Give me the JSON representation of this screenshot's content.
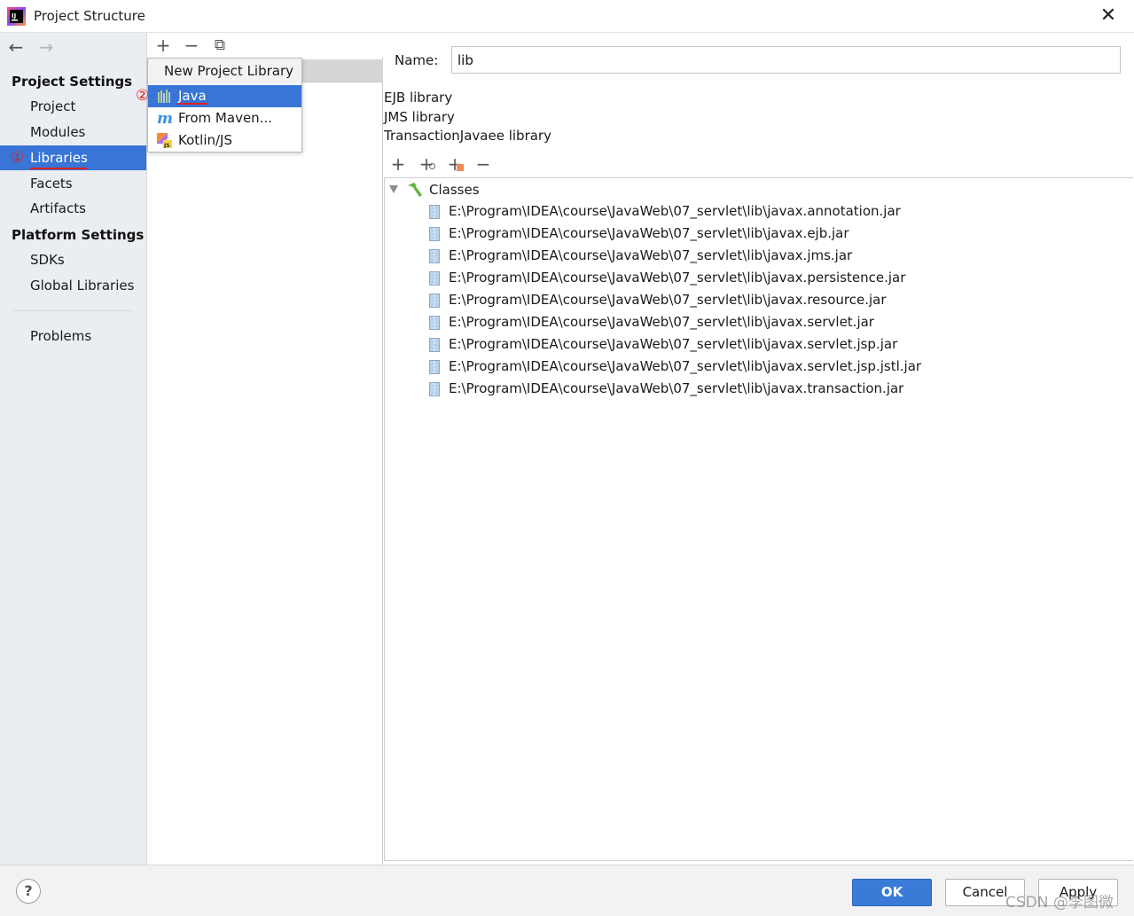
{
  "window": {
    "title": "Project Structure",
    "close_label": "✕"
  },
  "sidebar": {
    "nav_back": "←",
    "nav_forward": "→",
    "project_settings_title": "Project Settings",
    "platform_settings_title": "Platform Settings",
    "items": [
      {
        "label": "Project"
      },
      {
        "label": "Modules"
      },
      {
        "label": "Libraries",
        "selected": true,
        "annotation": "①"
      },
      {
        "label": "Facets"
      },
      {
        "label": "Artifacts"
      }
    ],
    "platform_items": [
      {
        "label": "SDKs"
      },
      {
        "label": "Global Libraries"
      }
    ],
    "problems_label": "Problems"
  },
  "middle": {
    "toolbar": {
      "add": "+",
      "remove": "−",
      "copy": "⧉"
    },
    "popup": {
      "header": "New Project Library",
      "annotation": "②",
      "items": [
        {
          "label": "Java",
          "icon": "java-library-icon",
          "selected": true
        },
        {
          "label": "From Maven...",
          "icon": "maven-icon"
        },
        {
          "label": "Kotlin/JS",
          "icon": "kotlin-js-icon"
        }
      ]
    }
  },
  "detail": {
    "name_label": "Name:",
    "name_value": "lib",
    "library_kinds": [
      "EJB library",
      "JMS library",
      "TransactionJavaee library"
    ],
    "toolbar": {
      "add": "+",
      "add_alt": "+",
      "add_alt2": "+",
      "remove": "−"
    },
    "tree": {
      "root_label": "Classes",
      "jars": [
        "E:\\Program\\IDEA\\course\\JavaWeb\\07_servlet\\lib\\javax.annotation.jar",
        "E:\\Program\\IDEA\\course\\JavaWeb\\07_servlet\\lib\\javax.ejb.jar",
        "E:\\Program\\IDEA\\course\\JavaWeb\\07_servlet\\lib\\javax.jms.jar",
        "E:\\Program\\IDEA\\course\\JavaWeb\\07_servlet\\lib\\javax.persistence.jar",
        "E:\\Program\\IDEA\\course\\JavaWeb\\07_servlet\\lib\\javax.resource.jar",
        "E:\\Program\\IDEA\\course\\JavaWeb\\07_servlet\\lib\\javax.servlet.jar",
        "E:\\Program\\IDEA\\course\\JavaWeb\\07_servlet\\lib\\javax.servlet.jsp.jar",
        "E:\\Program\\IDEA\\course\\JavaWeb\\07_servlet\\lib\\javax.servlet.jsp.jstl.jar",
        "E:\\Program\\IDEA\\course\\JavaWeb\\07_servlet\\lib\\javax.transaction.jar"
      ]
    }
  },
  "footer": {
    "help": "?",
    "ok": "OK",
    "cancel": "Cancel",
    "apply": "Apply",
    "watermark": "CSDN @李图微"
  },
  "colors": {
    "selection": "#3875d7",
    "annotation_red": "#e0201c",
    "ok_button": "#3a7bd8"
  }
}
